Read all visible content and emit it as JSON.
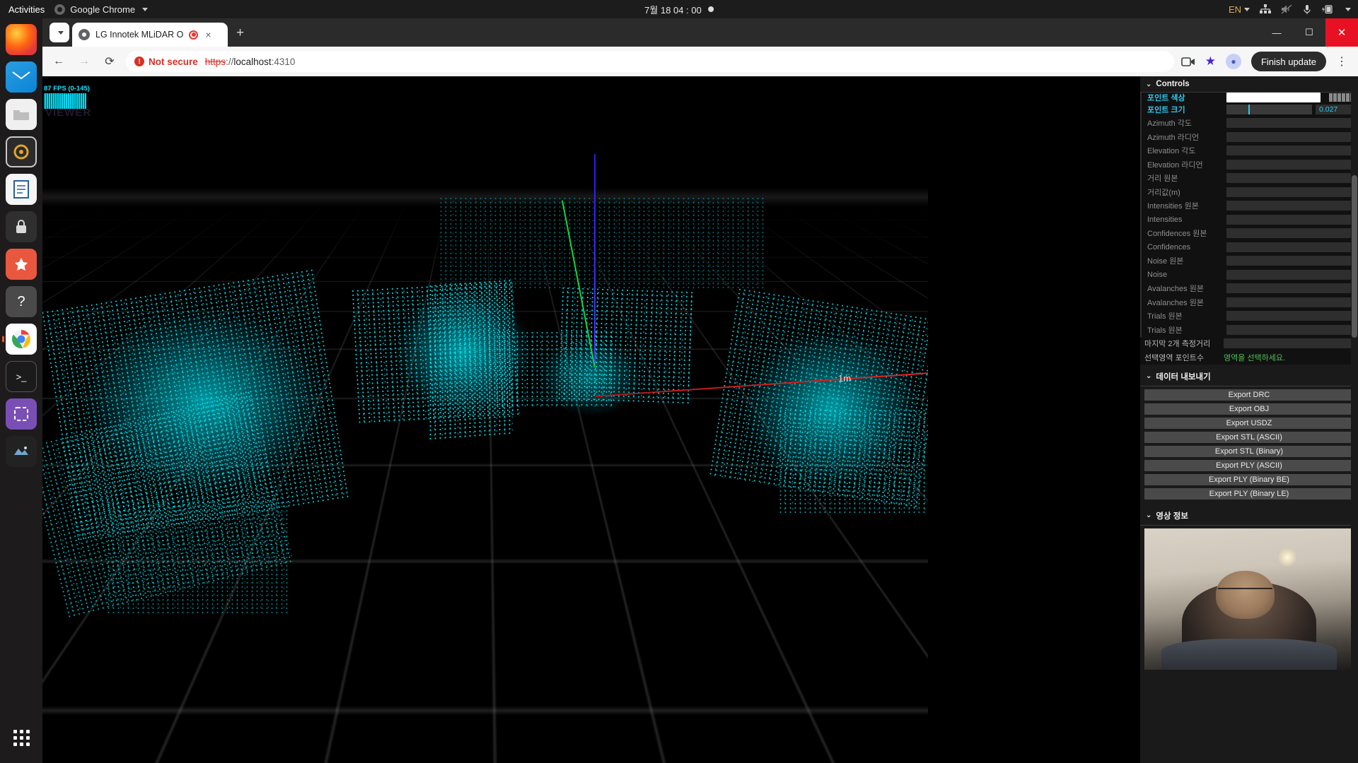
{
  "system": {
    "activities": "Activities",
    "app_name": "Google Chrome",
    "clock": "7월 18  04 : 00",
    "language": "EN",
    "tray_icons": [
      "network-icon",
      "speaker-muted-icon",
      "microphone-icon",
      "battery-charging-icon"
    ]
  },
  "dock": {
    "items": [
      {
        "name": "firefox",
        "label": "Firefox"
      },
      {
        "name": "thunderbird",
        "label": "Thunderbird"
      },
      {
        "name": "files",
        "label": "Files"
      },
      {
        "name": "rhythmbox",
        "label": "Rhythmbox"
      },
      {
        "name": "libreoffice-writer",
        "label": "LibreOffice Writer"
      },
      {
        "name": "app-center",
        "label": "App Center"
      },
      {
        "name": "help",
        "label": "Help"
      },
      {
        "name": "google-chrome",
        "label": "Google Chrome"
      },
      {
        "name": "terminal",
        "label": "Terminal"
      },
      {
        "name": "screenshot",
        "label": "Screenshot"
      },
      {
        "name": "misc-app",
        "label": "Application"
      },
      {
        "name": "show-apps",
        "label": "Show Applications"
      }
    ]
  },
  "browser": {
    "tab": {
      "title": "LG Innotek MLiDAR O",
      "recording": true,
      "close_label": "×"
    },
    "new_tab_label": "+",
    "window_buttons": {
      "minimize": "—",
      "maximize": "☐",
      "close": "✕"
    },
    "nav": {
      "back": "←",
      "forward": "→",
      "reload": "⟳"
    },
    "omnibox": {
      "security_label": "Not secure",
      "security_icon": "not-secure-icon",
      "url_scheme": "https",
      "url_separator": "://",
      "url_host": "localhost",
      "url_port": ":4310"
    },
    "toolbar_right": {
      "cast_icon": "camera-icon",
      "bookmark_icon": "star-icon",
      "profile_icon": "profile-avatar",
      "update_label": "Finish update",
      "menu_label": "⋮"
    }
  },
  "viewport": {
    "fps_label": "87 FPS (0-145)",
    "watermark": "3D VIEWER",
    "scale_label": "1m",
    "axes": {
      "x": "#ee2222",
      "y": "#19d43a",
      "z": "#3a2ae8"
    },
    "point_color": "#00e5ff"
  },
  "panel": {
    "controls": {
      "title": "Controls",
      "rows": [
        {
          "label": "포인트 색상",
          "type": "color",
          "value": ""
        },
        {
          "label": "포인트 크기",
          "type": "slider",
          "value": "0.027",
          "highlight": true
        },
        {
          "label": "Azimuth 각도",
          "type": "field",
          "value": ""
        },
        {
          "label": "Azimuth 라디언",
          "type": "field",
          "value": ""
        },
        {
          "label": "Elevation 각도",
          "type": "field",
          "value": ""
        },
        {
          "label": "Elevation 라디언",
          "type": "field",
          "value": ""
        },
        {
          "label": "거리 원본",
          "type": "field",
          "value": ""
        },
        {
          "label": "거리값(m)",
          "type": "field",
          "value": ""
        },
        {
          "label": "Intensities 원본",
          "type": "field",
          "value": ""
        },
        {
          "label": "Intensities",
          "type": "field",
          "value": ""
        },
        {
          "label": "Confidences 원본",
          "type": "field",
          "value": ""
        },
        {
          "label": "Confidences",
          "type": "field",
          "value": ""
        },
        {
          "label": "Noise 원본",
          "type": "field",
          "value": ""
        },
        {
          "label": "Noise",
          "type": "field",
          "value": ""
        },
        {
          "label": "Avalanches 원본",
          "type": "field",
          "value": ""
        },
        {
          "label": "Avalanches 원본",
          "type": "field",
          "value": ""
        },
        {
          "label": "Trials 원본",
          "type": "field",
          "value": ""
        },
        {
          "label": "Trials 원본",
          "type": "field",
          "value": ""
        }
      ],
      "footer_rows": [
        {
          "label": "마지막 2개 측정거리",
          "type": "field",
          "value": ""
        },
        {
          "label": "선택영역 포인트수",
          "type": "note",
          "value": "영역을 선택하세요."
        }
      ]
    },
    "export": {
      "title": "데이터 내보내기",
      "buttons": [
        "Export DRC",
        "Export OBJ",
        "Export USDZ",
        "Export STL (ASCII)",
        "Export STL (Binary)",
        "Export PLY (ASCII)",
        "Export PLY (Binary BE)",
        "Export PLY (Binary LE)"
      ]
    },
    "video": {
      "title": "영상 정보"
    }
  }
}
